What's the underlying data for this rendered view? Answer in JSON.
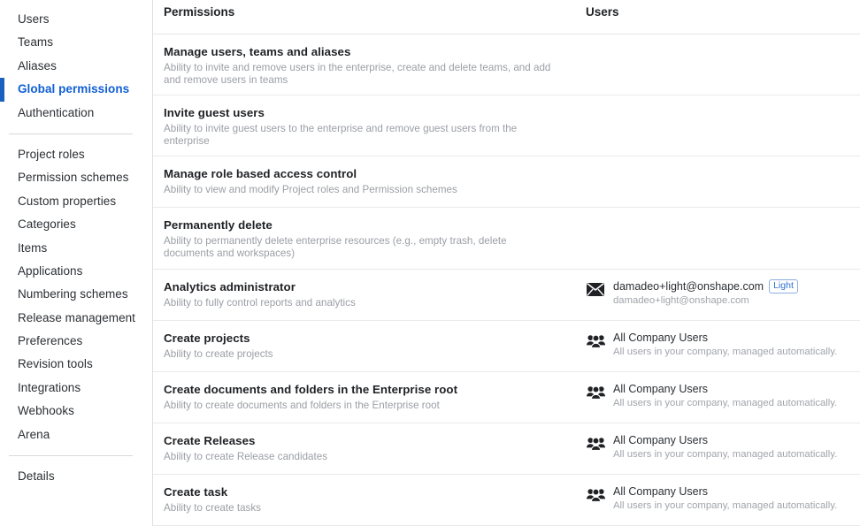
{
  "sidebar": {
    "groups": [
      {
        "items": [
          {
            "label": "Users",
            "active": false
          },
          {
            "label": "Teams",
            "active": false
          },
          {
            "label": "Aliases",
            "active": false
          },
          {
            "label": "Global permissions",
            "active": true
          },
          {
            "label": "Authentication",
            "active": false
          }
        ]
      },
      {
        "items": [
          {
            "label": "Project roles",
            "active": false
          },
          {
            "label": "Permission schemes",
            "active": false
          },
          {
            "label": "Custom properties",
            "active": false
          },
          {
            "label": "Categories",
            "active": false
          },
          {
            "label": "Items",
            "active": false
          },
          {
            "label": "Applications",
            "active": false
          },
          {
            "label": "Numbering schemes",
            "active": false
          },
          {
            "label": "Release management",
            "active": false
          },
          {
            "label": "Preferences",
            "active": false
          },
          {
            "label": "Revision tools",
            "active": false
          },
          {
            "label": "Integrations",
            "active": false
          },
          {
            "label": "Webhooks",
            "active": false
          },
          {
            "label": "Arena",
            "active": false
          }
        ]
      },
      {
        "items": [
          {
            "label": "Details",
            "active": false
          }
        ]
      }
    ],
    "active_color": "#1960c0"
  },
  "table": {
    "columns": {
      "permissions": "Permissions",
      "users": "Users"
    },
    "rows": [
      {
        "title": "Manage users, teams and aliases",
        "description": "Ability to invite and remove users in the enterprise, create and delete teams, and add and remove users in teams",
        "assignee": null
      },
      {
        "title": "Invite guest users",
        "description": "Ability to invite guest users to the enterprise and remove guest users from the enterprise",
        "assignee": null
      },
      {
        "title": "Manage role based access control",
        "description": "Ability to view and modify Project roles and Permission schemes",
        "assignee": null
      },
      {
        "title": "Permanently delete",
        "description": "Ability to permanently delete enterprise resources (e.g., empty trash, delete documents and workspaces)",
        "assignee": null
      },
      {
        "title": "Analytics administrator",
        "description": "Ability to fully control reports and analytics",
        "assignee": {
          "icon": "envelope-icon",
          "primary": "damadeo+light@onshape.com",
          "badge": "Light",
          "secondary": "damadeo+light@onshape.com"
        }
      },
      {
        "title": "Create projects",
        "description": "Ability to create projects",
        "assignee": {
          "icon": "group-users-icon",
          "primary": "All Company Users",
          "badge": null,
          "secondary": "All users in your company, managed automatically."
        }
      },
      {
        "title": "Create documents and folders in the Enterprise root",
        "description": "Ability to create documents and folders in the Enterprise root",
        "assignee": {
          "icon": "group-users-icon",
          "primary": "All Company Users",
          "badge": null,
          "secondary": "All users in your company, managed automatically."
        }
      },
      {
        "title": "Create Releases",
        "description": "Ability to create Release candidates",
        "assignee": {
          "icon": "group-users-icon",
          "primary": "All Company Users",
          "badge": null,
          "secondary": "All users in your company, managed automatically."
        }
      },
      {
        "title": "Create task",
        "description": "Ability to create tasks",
        "assignee": {
          "icon": "group-users-icon",
          "primary": "All Company Users",
          "badge": null,
          "secondary": "All users in your company, managed automatically."
        }
      }
    ]
  }
}
